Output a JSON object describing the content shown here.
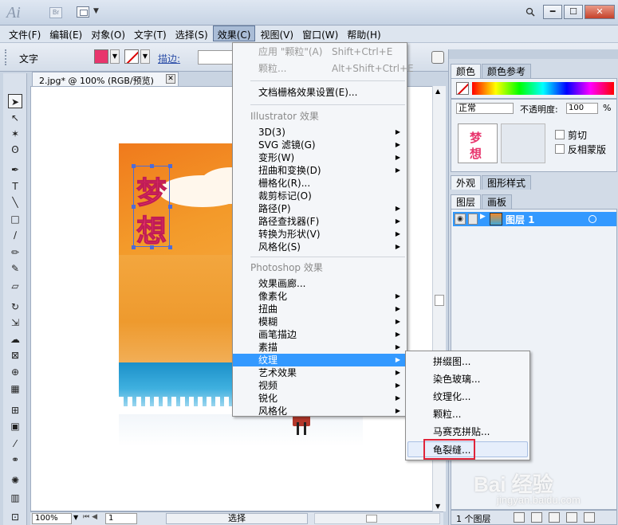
{
  "app": {
    "logo": "Ai",
    "bridge_label": "Br",
    "window_buttons": [
      "━",
      "☐",
      "✕"
    ]
  },
  "menubar": {
    "items": [
      "文件(F)",
      "编辑(E)",
      "对象(O)",
      "文字(T)",
      "选择(S)",
      "效果(C)",
      "视图(V)",
      "窗口(W)",
      "帮助(H)"
    ]
  },
  "controlbar": {
    "label": "文字",
    "fill_color": "#e8356d",
    "stroke_label": "描边:"
  },
  "document": {
    "tab_title": "2.jpg* @ 100% (RGB/预览)",
    "close_glyph": "✕",
    "text_chars": [
      "梦",
      "想"
    ]
  },
  "statusbar": {
    "zoom": "100%",
    "page": "1",
    "tool_status": "选择"
  },
  "effects_menu": {
    "items": [
      {
        "label": "应用 \"颗粒\"(A)",
        "shortcut": "Shift+Ctrl+E",
        "disabled": true
      },
      {
        "label": "颗粒...",
        "shortcut": "Alt+Shift+Ctrl+E",
        "disabled": true
      },
      {
        "label": "文档栅格效果设置(E)..."
      },
      {
        "label": "Illustrator 效果",
        "section": true
      },
      {
        "label": "3D(3)",
        "submenu": true
      },
      {
        "label": "SVG 滤镜(G)",
        "submenu": true
      },
      {
        "label": "变形(W)",
        "submenu": true
      },
      {
        "label": "扭曲和变换(D)",
        "submenu": true
      },
      {
        "label": "栅格化(R)..."
      },
      {
        "label": "裁剪标记(O)"
      },
      {
        "label": "路径(P)",
        "submenu": true
      },
      {
        "label": "路径查找器(F)",
        "submenu": true
      },
      {
        "label": "转换为形状(V)",
        "submenu": true
      },
      {
        "label": "风格化(S)",
        "submenu": true
      },
      {
        "label": "Photoshop 效果",
        "section": true
      },
      {
        "label": "效果画廊..."
      },
      {
        "label": "像素化",
        "submenu": true
      },
      {
        "label": "扭曲",
        "submenu": true
      },
      {
        "label": "模糊",
        "submenu": true
      },
      {
        "label": "画笔描边",
        "submenu": true
      },
      {
        "label": "素描",
        "submenu": true
      },
      {
        "label": "纹理",
        "submenu": true,
        "highlight": true
      },
      {
        "label": "艺术效果",
        "submenu": true
      },
      {
        "label": "视频",
        "submenu": true
      },
      {
        "label": "锐化",
        "submenu": true
      },
      {
        "label": "风格化",
        "submenu": true
      }
    ]
  },
  "texture_submenu": {
    "items": [
      "拼缀图...",
      "染色玻璃...",
      "纹理化...",
      "颗粒...",
      "马赛克拼贴...",
      "龟裂缝..."
    ],
    "hover_index": 5,
    "highlight_box_color": "#e0243a"
  },
  "color_panel": {
    "tabs": [
      "颜色",
      "颜色参考"
    ]
  },
  "transparency_panel": {
    "blend_mode": "正常",
    "opacity_label": "不透明度:",
    "opacity_value": "100",
    "pct": "%",
    "clip_label": "剪切",
    "invert_mask_label": "反相蒙版"
  },
  "appearance_panel": {
    "tabs": [
      "外观",
      "图形样式"
    ]
  },
  "layers_panel": {
    "tabs": [
      "图层",
      "画板"
    ],
    "layer_name": "图层 1",
    "footer_count": "1 个图层"
  },
  "watermark": {
    "main": "Bai 经验",
    "sub": "jingyan.baidu.com"
  }
}
